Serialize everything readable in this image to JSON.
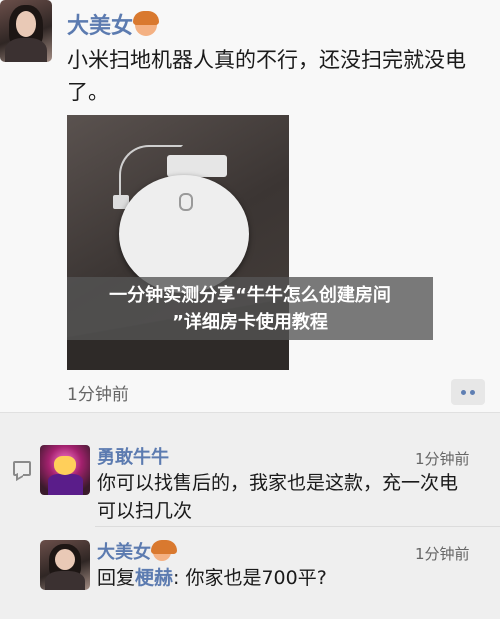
{
  "post": {
    "author": "大美女",
    "text": "小米扫地机器人真的不行，还没扫完就没电了。",
    "time": "1分钟前"
  },
  "banner": {
    "line1": "一分钟实测分享“牛牛怎么创建房间",
    "line2": "”详细房卡使用教程"
  },
  "comments": [
    {
      "author": "勇敢牛牛",
      "time": "1分钟前",
      "text": "你可以找售后的，我家也是这款，充一次电可以扫几次"
    },
    {
      "author": "大美女",
      "time": "1分钟前",
      "reply_prefix": "回复",
      "reply_to": "梗赫",
      "text": ": 你家也是700平?"
    }
  ],
  "icons": {
    "emoji": "girl-emoji-icon",
    "comment": "comment-icon",
    "more": "more-dots-icon"
  },
  "colors": {
    "name": "#5c7bb0",
    "banner_bg": "#555555"
  }
}
